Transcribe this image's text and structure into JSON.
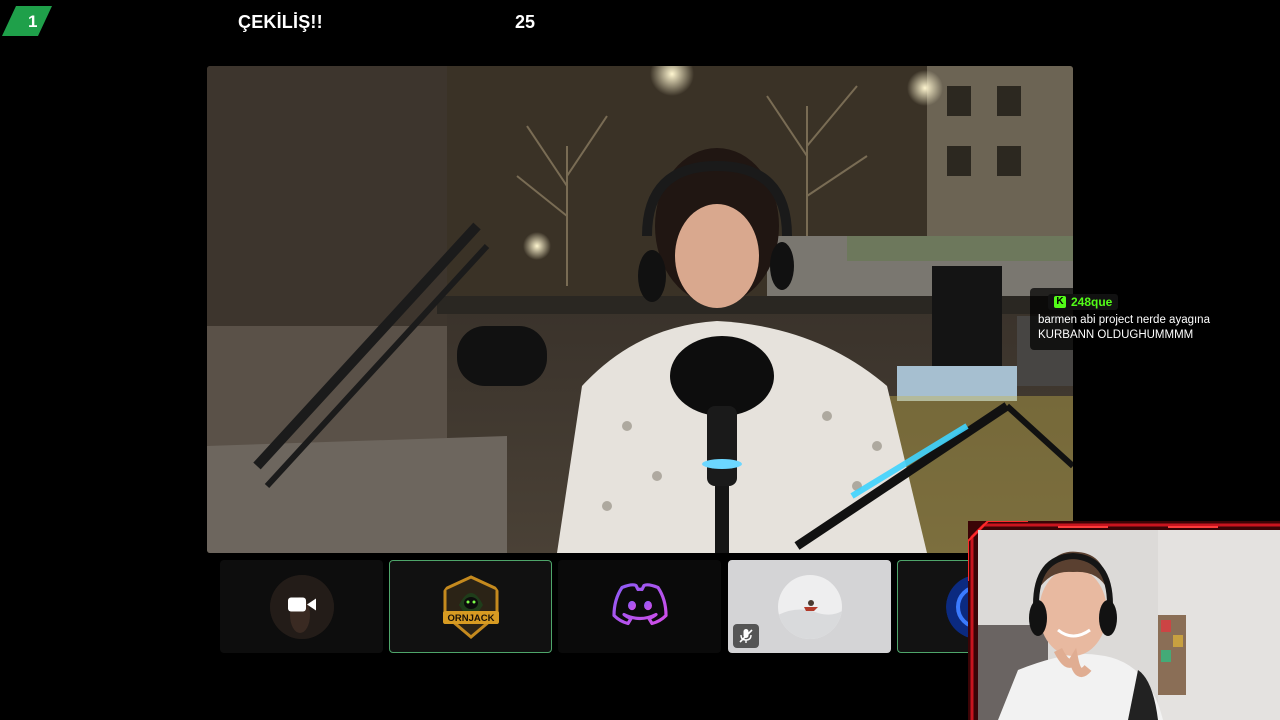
{
  "header": {
    "badge_number": "1",
    "title": "ÇEKİLİŞ!!",
    "count": "25"
  },
  "colors": {
    "accent_green": "#53fc18",
    "tile_border": "#4ea56a",
    "frame_red": "#c8141e"
  },
  "participants": [
    {
      "id": "camera-tile",
      "icon": "video-camera-icon"
    },
    {
      "id": "ornjack-tile",
      "logo_text": "ORNJACK",
      "active": true
    },
    {
      "id": "discord-tile",
      "icon": "discord-icon"
    },
    {
      "id": "snow-avatar-tile",
      "icon": "mic-muted-icon",
      "muted": true
    },
    {
      "id": "blue-avatar-tile",
      "active": true
    }
  ],
  "chat": {
    "username": "248que",
    "platform_icon": "kick-icon",
    "message_line1": "barmen abi project nerde ayagına",
    "message_line2": "KURBANN OLDUGHUMMMM"
  }
}
